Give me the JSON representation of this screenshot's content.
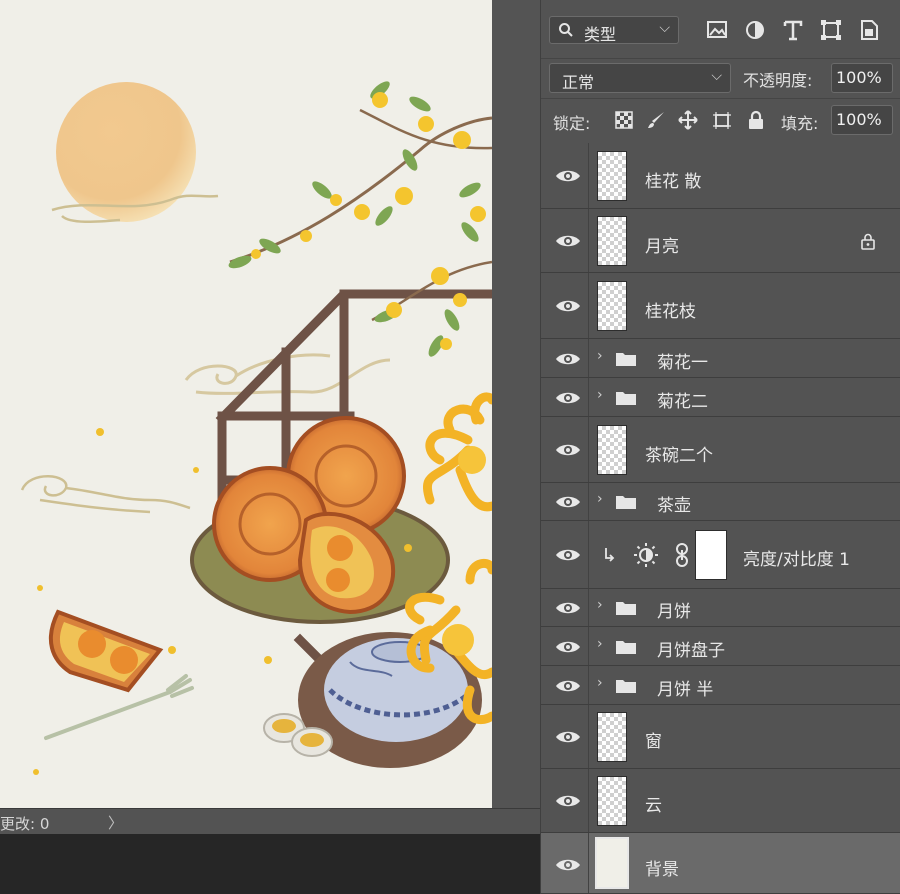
{
  "status": {
    "changes_text": "更改: 0",
    "arrow": "〉"
  },
  "layers_panel": {
    "filter": {
      "type_label": "类型",
      "icons": [
        "image-filter-icon",
        "adjustment-filter-icon",
        "type-filter-icon",
        "shape-filter-icon",
        "smart-object-filter-icon"
      ]
    },
    "blend_mode": "正常",
    "opacity_label": "不透明度:",
    "opacity_value": "100%",
    "lock_label": "锁定:",
    "fill_label": "填充:",
    "fill_value": "100%",
    "layers": [
      {
        "name": "桂花 散",
        "kind": "pixel"
      },
      {
        "name": "月亮",
        "kind": "pixel",
        "locked": true
      },
      {
        "name": "桂花枝",
        "kind": "pixel"
      },
      {
        "name": "菊花一",
        "kind": "group"
      },
      {
        "name": "菊花二",
        "kind": "group"
      },
      {
        "name": "茶碗二个",
        "kind": "pixel"
      },
      {
        "name": "茶壶",
        "kind": "group"
      },
      {
        "name": "亮度/对比度 1",
        "kind": "adjustment",
        "clipped": true
      },
      {
        "name": "月饼",
        "kind": "group"
      },
      {
        "name": "月饼盘子",
        "kind": "group"
      },
      {
        "name": "月饼 半",
        "kind": "group"
      },
      {
        "name": "窗",
        "kind": "pixel"
      },
      {
        "name": "云",
        "kind": "pixel"
      },
      {
        "name": "背景",
        "kind": "background",
        "selected": true
      }
    ]
  },
  "colors": {
    "canvas_bg": "#f0efe8",
    "panel_bg": "#535353",
    "selected_row": "#6a6a6a"
  }
}
